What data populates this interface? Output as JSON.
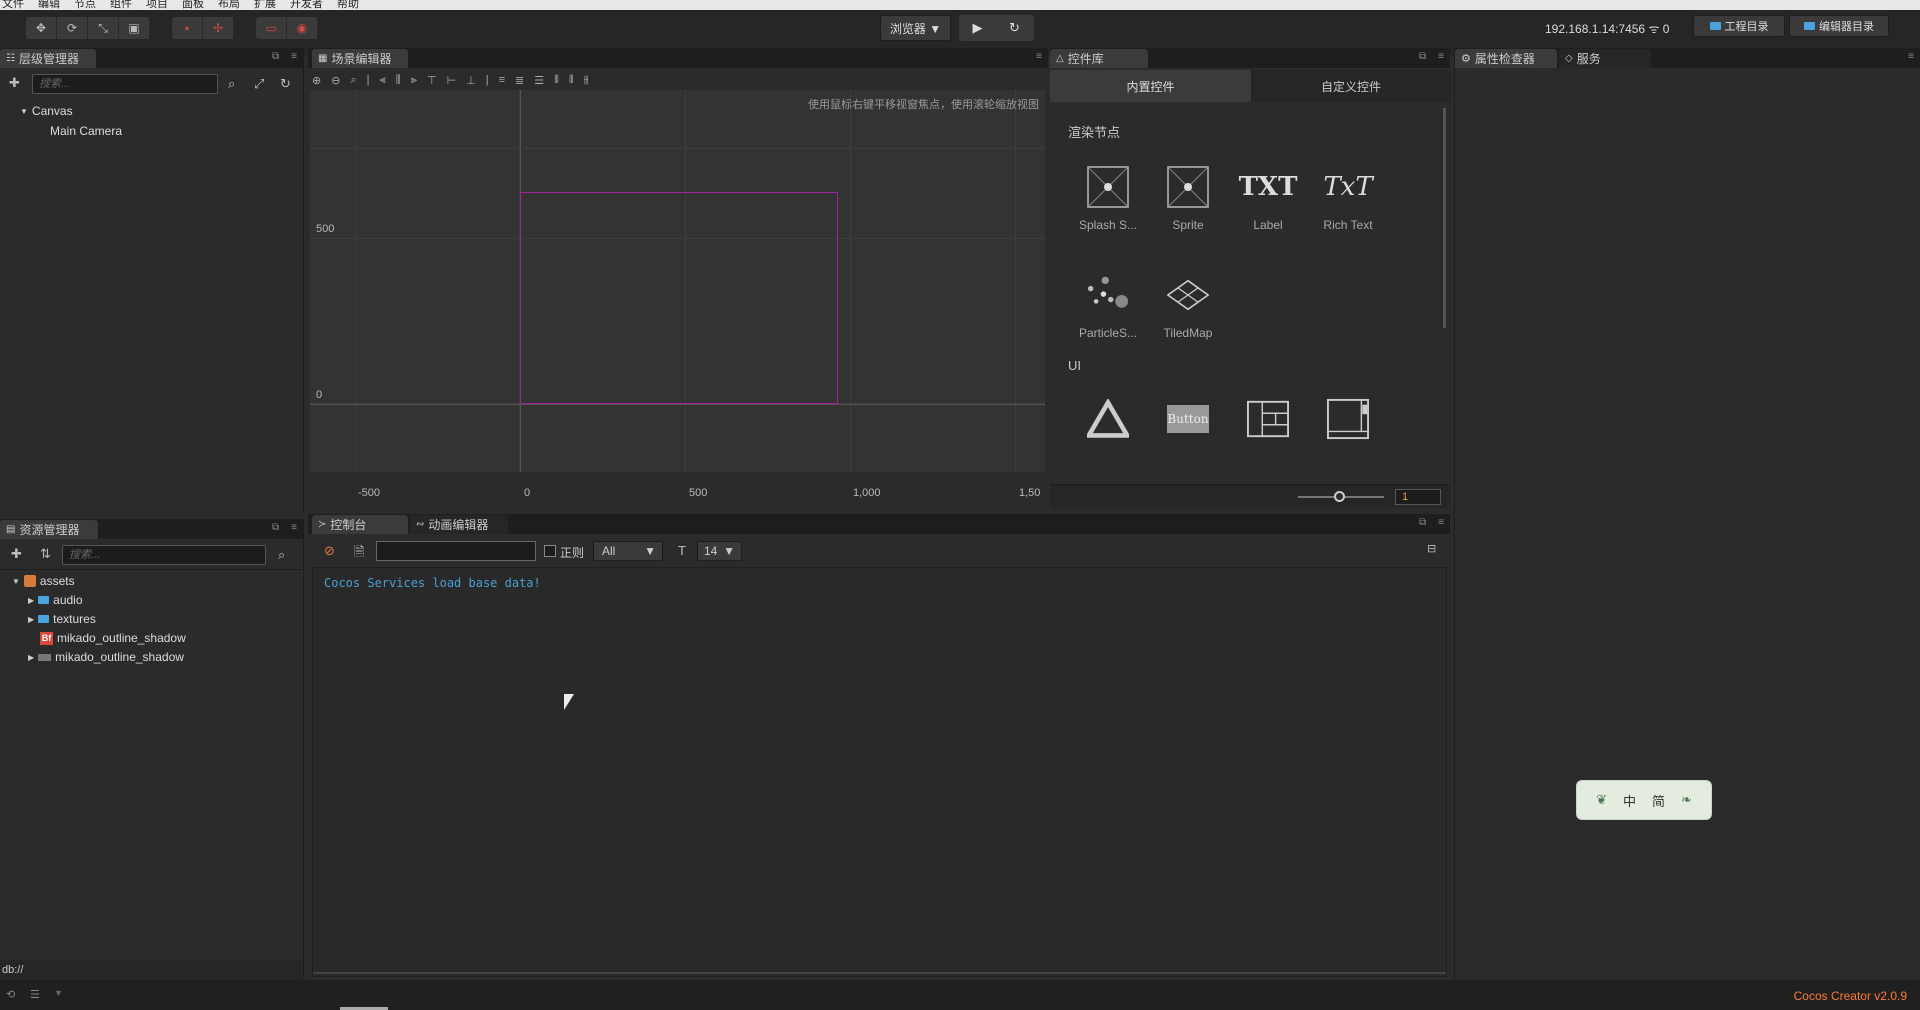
{
  "menu": [
    "文件",
    "编辑",
    "节点",
    "组件",
    "项目",
    "面板",
    "布局",
    "扩展",
    "开发者",
    "帮助"
  ],
  "toolbar": {
    "browser_label": "浏览器 ▼",
    "play_icon": "play-icon",
    "refresh_icon": "refresh-icon",
    "ip_address": "192.168.1.14:7456",
    "connections": "0",
    "project_dir_label": "工程目录",
    "editor_dir_label": "编辑器目录"
  },
  "hierarchy": {
    "tab_label": "层级管理器",
    "search_placeholder": "搜索...",
    "nodes": [
      "Canvas",
      "Main Camera"
    ]
  },
  "scene": {
    "tab_label": "场景编辑器",
    "hint": "使用鼠标右键平移视窗焦点，使用滚轮缩放视图",
    "y_labels": [
      "500",
      "0"
    ],
    "x_labels": [
      "-500",
      "0",
      "500",
      "1,000",
      "1,50"
    ],
    "canvas_color": "#a0259a"
  },
  "library": {
    "tab_label": "控件库",
    "subtab_builtin": "内置控件",
    "subtab_custom": "自定义控件",
    "section_render": "渲染节点",
    "section_ui": "UI",
    "render_items": [
      "Splash S...",
      "Sprite",
      "Label",
      "Rich Text",
      "ParticleS...",
      "TiledMap"
    ],
    "label_glyph": "TXT",
    "richtext_glyph": "TxT",
    "button_glyph": "Button",
    "zoom_value": "1"
  },
  "inspector": {
    "tab_label": "属性检查器",
    "services_label": "服务"
  },
  "assets": {
    "tab_label": "资源管理器",
    "search_placeholder": "搜索...",
    "root": "assets",
    "items": [
      "audio",
      "textures",
      "mikado_outline_shadow",
      "mikado_outline_shadow"
    ],
    "path": "db://"
  },
  "console": {
    "tab_label": "控制台",
    "anim_tab_label": "动画编辑器",
    "regex_label": "正则",
    "level_filter": "All",
    "font_size": "14",
    "messages": [
      "Cocos Services load base data!"
    ],
    "message_color": "#4a9fd4"
  },
  "ime": {
    "lang": "中",
    "mode": "简"
  },
  "status": {
    "version": "Cocos Creator v2.0.9",
    "version_color": "#ff7a2e"
  }
}
